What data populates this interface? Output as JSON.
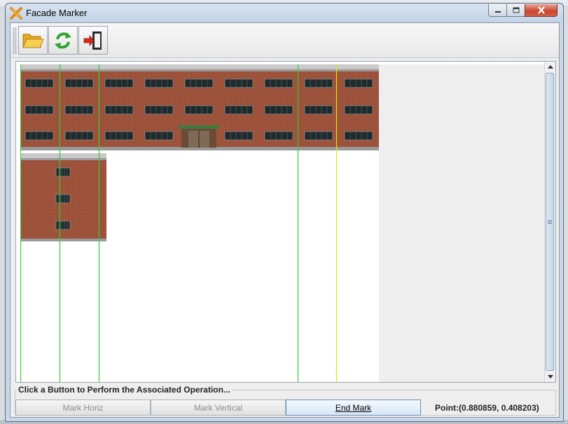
{
  "window": {
    "title": "Facade Marker",
    "icon": "x-logo-icon",
    "controls": {
      "minimize": "minimize-icon",
      "maximize": "maximize-icon",
      "close": "close-icon"
    }
  },
  "toolbar": {
    "buttons": [
      {
        "name": "open-folder-button",
        "icon": "folder-open-icon"
      },
      {
        "name": "refresh-button",
        "icon": "refresh-icon"
      },
      {
        "name": "exit-button",
        "icon": "exit-icon"
      }
    ]
  },
  "canvas": {
    "marker_lines": [
      {
        "color": "#33cc33"
      },
      {
        "color": "#33cc33"
      },
      {
        "color": "#33cc33"
      },
      {
        "color": "#33cc33"
      },
      {
        "color": "#e6e600"
      }
    ]
  },
  "operations": {
    "title": "Click a Button to Perform the Associated Operation...",
    "mark_horiz": "Mark Horiz",
    "mark_vertical": "Mark Vertical",
    "end_mark": "End Mark",
    "point": "Point:(0.880859, 0.408203)"
  },
  "colors": {
    "brick": "#a1553d",
    "green_marker": "#33cc33",
    "yellow_marker": "#e6e600",
    "accent_button": "#6d8eb3"
  }
}
